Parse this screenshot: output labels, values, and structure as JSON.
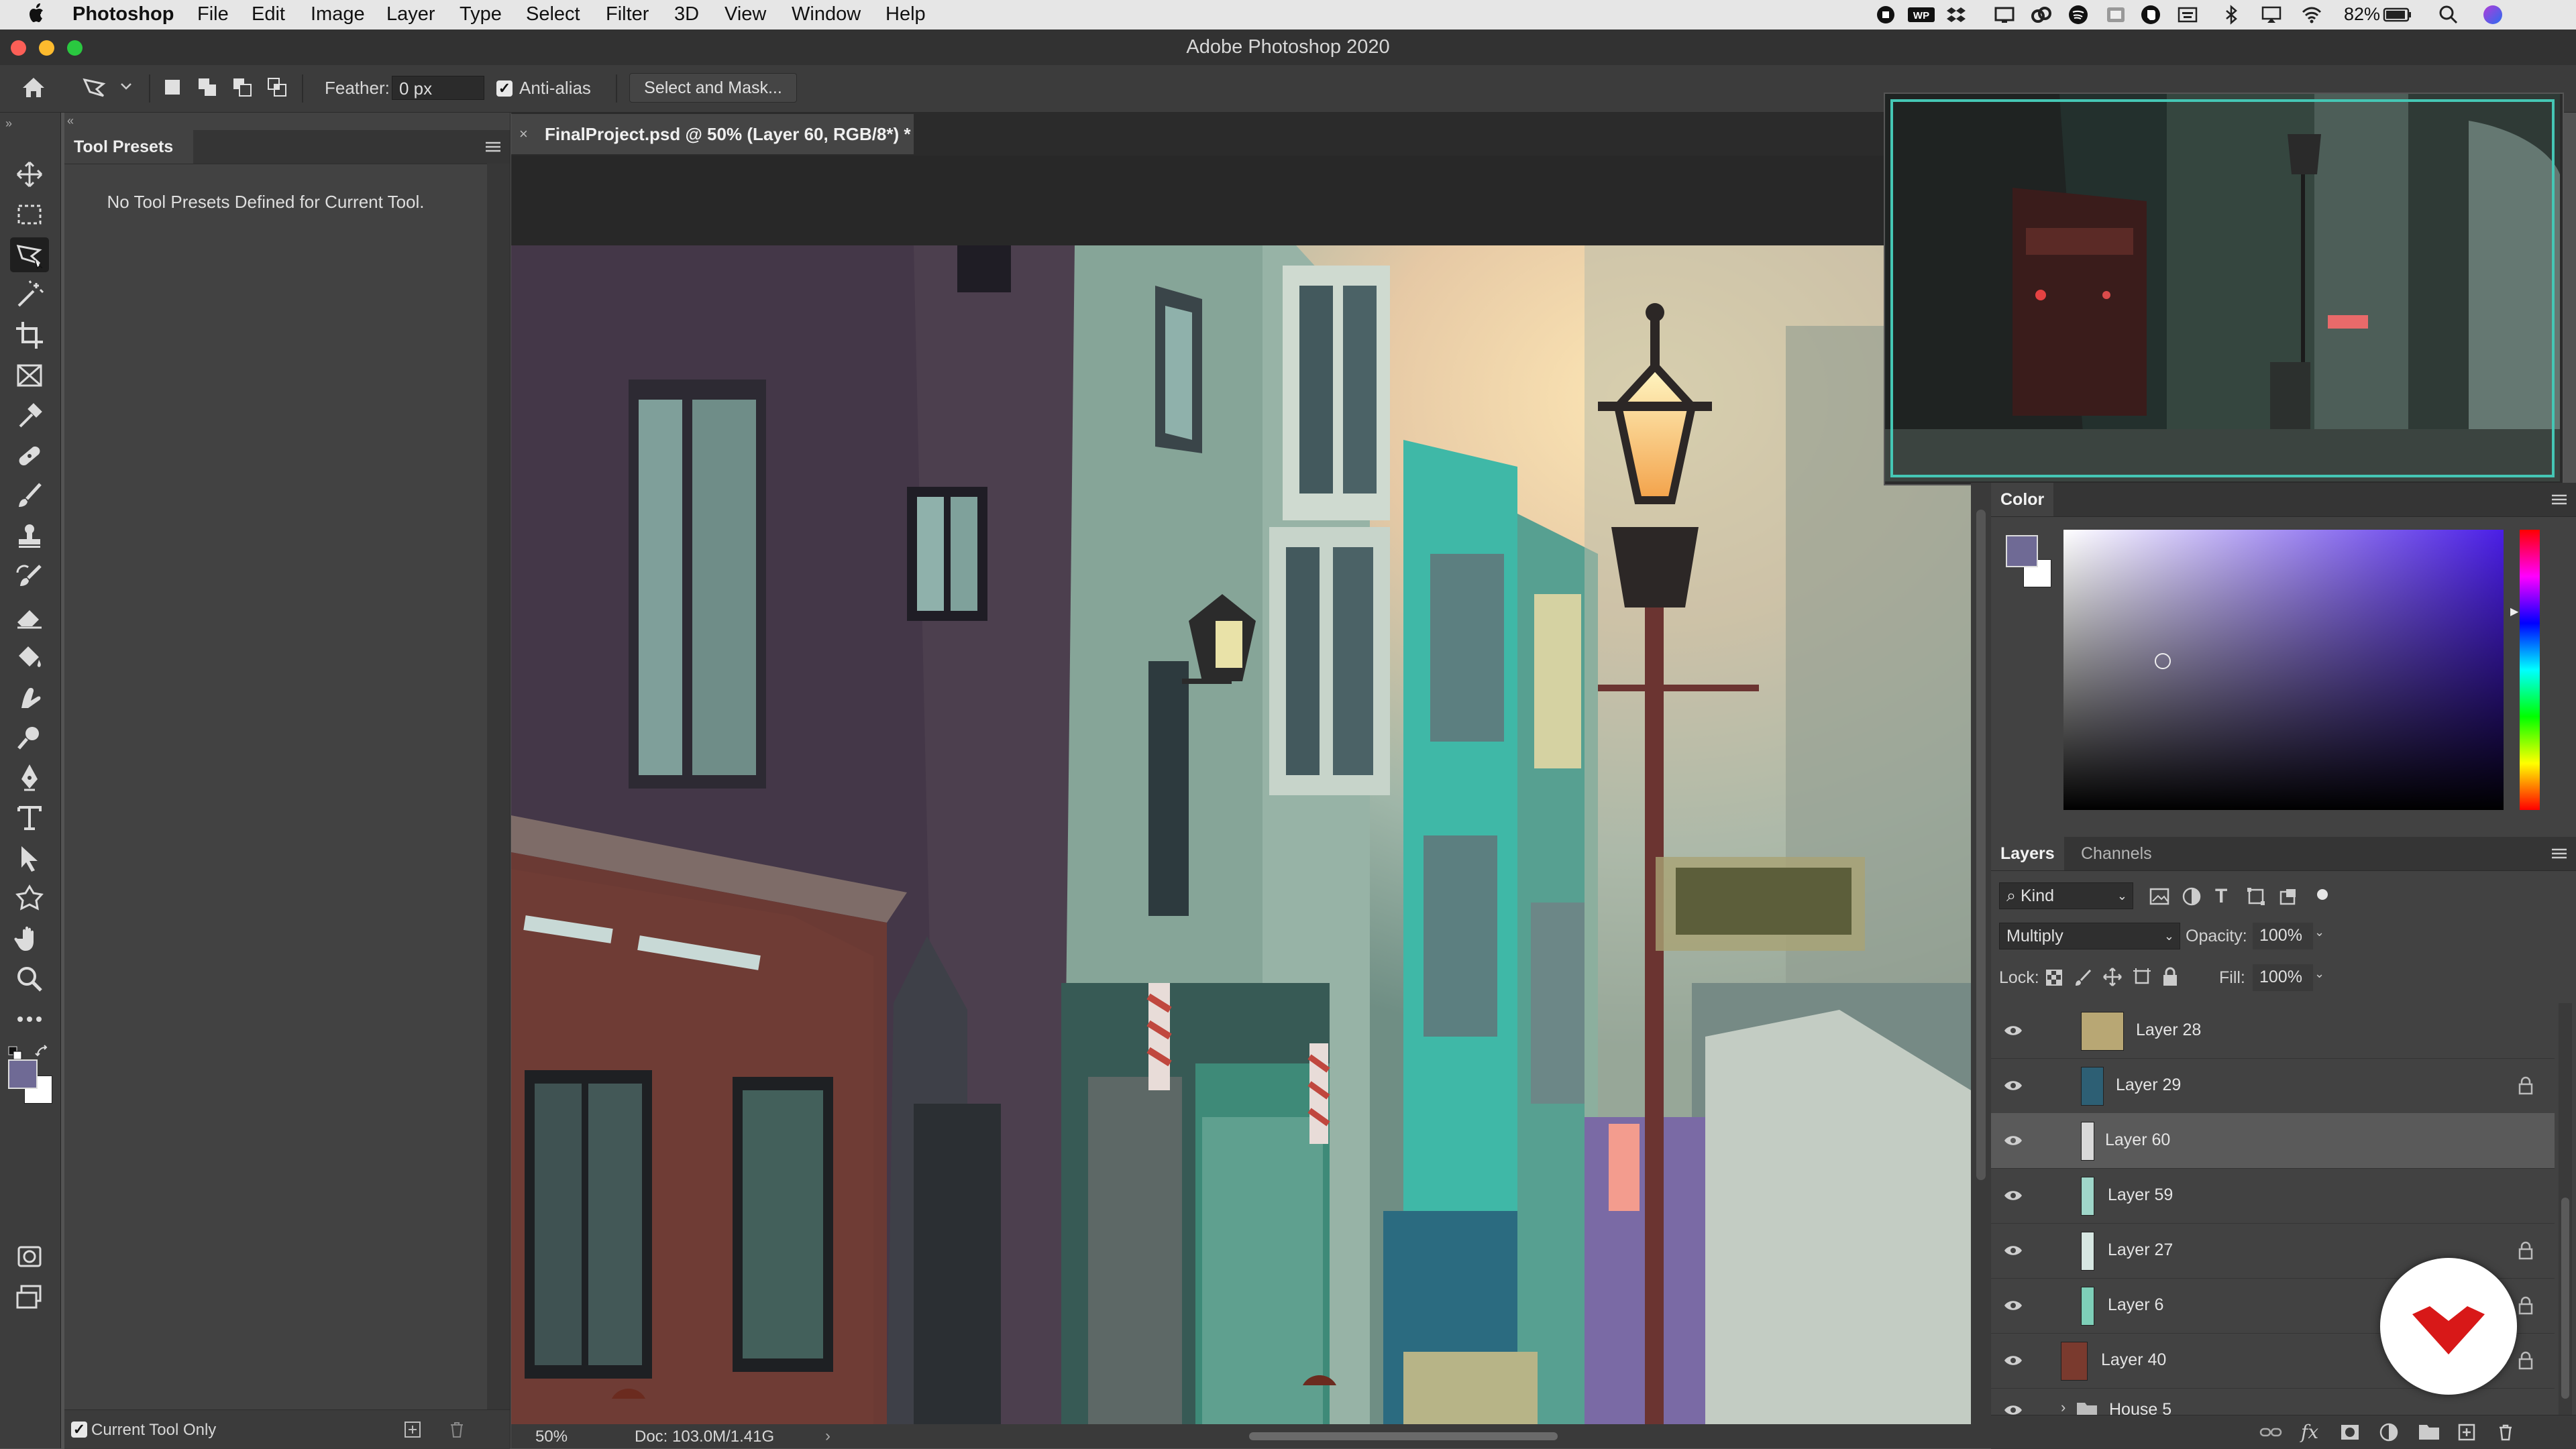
{
  "menubar": {
    "app_name": "Photoshop",
    "items": [
      "File",
      "Edit",
      "Image",
      "Layer",
      "Type",
      "Select",
      "Filter",
      "3D",
      "View",
      "Window",
      "Help"
    ],
    "battery": "82%",
    "status_icons": [
      "record-icon",
      "wp-icon",
      "dropbox-icon",
      "screen-icon",
      "creative-cloud-icon",
      "spotify-icon",
      "folder-icon",
      "evernote-icon",
      "keyboard-icon",
      "bluetooth-icon",
      "airplay-icon",
      "wifi-icon",
      "battery-icon",
      "search-icon",
      "siri-icon"
    ]
  },
  "window": {
    "title": "Adobe Photoshop 2020"
  },
  "options": {
    "feather_label": "Feather:",
    "feather_value": "0 px",
    "antialias_label": "Anti-alias",
    "antialias_checked": true,
    "select_mask_label": "Select and Mask..."
  },
  "tool_presets": {
    "title": "Tool Presets",
    "empty_message": "No Tool Presets Defined for Current Tool.",
    "current_tool_only_label": "Current Tool Only",
    "current_tool_only_checked": true
  },
  "document": {
    "tab_title": "FinalProject.psd @ 50% (Layer 60, RGB/8*) *",
    "zoom": "50%",
    "doc_size": "Doc: 103.0M/1.41G"
  },
  "color_panel": {
    "title": "Color",
    "foreground": "#6f6a95",
    "background": "#ffffff",
    "hue_color": "#4a1ee6"
  },
  "layers_panel": {
    "tabs": [
      "Layers",
      "Channels"
    ],
    "filter_kind": "Kind",
    "blend_mode": "Multiply",
    "opacity_label": "Opacity:",
    "opacity_value": "100%",
    "lock_label": "Lock:",
    "fill_label": "Fill:",
    "fill_value": "100%",
    "layers": [
      {
        "name": "Layer 28",
        "locked": false,
        "selected": false,
        "thumb": "#b8a774"
      },
      {
        "name": "Layer 29",
        "locked": true,
        "selected": false,
        "thumb": "#2d5f74"
      },
      {
        "name": "Layer 60",
        "locked": false,
        "selected": true,
        "thumb": "#d9d9d9"
      },
      {
        "name": "Layer 59",
        "locked": false,
        "selected": false,
        "thumb": "#9fd6c9"
      },
      {
        "name": "Layer 27",
        "locked": true,
        "selected": false,
        "thumb": "#d7e7e2"
      },
      {
        "name": "Layer 6",
        "locked": true,
        "selected": false,
        "thumb": "#7ecfb8"
      },
      {
        "name": "Layer 40",
        "locked": true,
        "selected": false,
        "thumb": "#7a3a2e"
      },
      {
        "name": "House 5",
        "locked": false,
        "selected": false,
        "thumb": "folder"
      }
    ]
  }
}
